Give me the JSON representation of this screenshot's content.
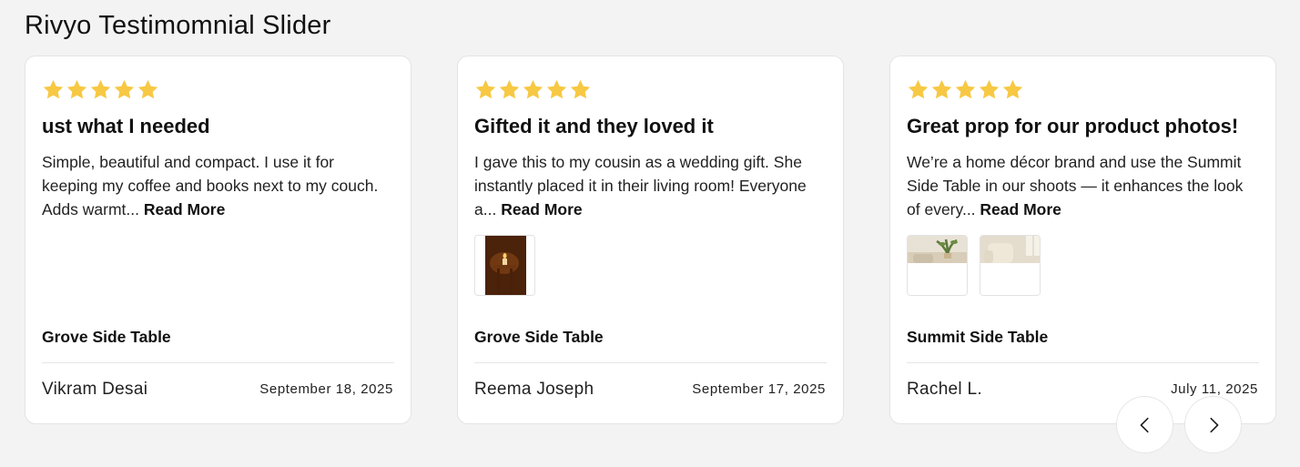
{
  "page": {
    "title": "Rivyo Testimomnial Slider"
  },
  "colors": {
    "star": "#f7c843",
    "text": "#111111",
    "card_border": "#e4e4e4"
  },
  "icons": {
    "star": "star-icon",
    "prev": "chevron-left-icon",
    "next": "chevron-right-icon"
  },
  "testimonials": [
    {
      "rating": 5,
      "headline": "ust what I needed",
      "body": "Simple, beautiful and compact. I use it for keeping my coffee and books next to my couch. Adds warmt...",
      "read_more": "Read More",
      "photos": [],
      "product": "Grove Side Table",
      "author": "Vikram Desai",
      "date": "September 18, 2025"
    },
    {
      "rating": 5,
      "headline": "Gifted it and they loved it",
      "body": "I gave this to my cousin as a wedding gift. She instantly placed it in their living room! Everyone a...",
      "read_more": "Read More",
      "photos": [
        "candle-on-table-photo"
      ],
      "product": "Grove Side Table",
      "author": "Reema Joseph",
      "date": "September 17, 2025"
    },
    {
      "rating": 5,
      "headline": "Great prop for our product photos!",
      "body": "We’re a home décor brand and use the Summit Side Table in our shoots — it enhances the look of every...",
      "read_more": "Read More",
      "photos": [
        "plant-on-table-photo",
        "armchair-room-photo"
      ],
      "product": "Summit Side Table",
      "author": "Rachel L.",
      "date": "July 11, 2025"
    }
  ]
}
